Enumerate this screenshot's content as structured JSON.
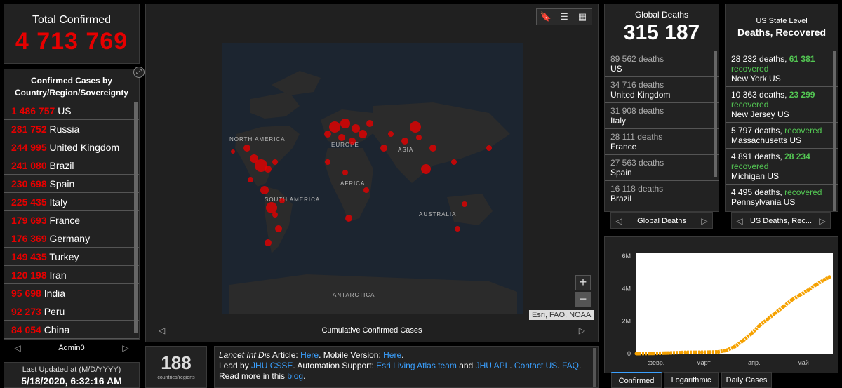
{
  "total": {
    "label": "Total Confirmed",
    "value": "4 713 769"
  },
  "countries": {
    "header": "Confirmed Cases by Country/Region/Sovereignty",
    "items": [
      {
        "value": "1 486 757",
        "name": "US"
      },
      {
        "value": "281 752",
        "name": "Russia"
      },
      {
        "value": "244 995",
        "name": "United Kingdom"
      },
      {
        "value": "241 080",
        "name": "Brazil"
      },
      {
        "value": "230 698",
        "name": "Spain"
      },
      {
        "value": "225 435",
        "name": "Italy"
      },
      {
        "value": "179 693",
        "name": "France"
      },
      {
        "value": "176 369",
        "name": "Germany"
      },
      {
        "value": "149 435",
        "name": "Turkey"
      },
      {
        "value": "120 198",
        "name": "Iran"
      },
      {
        "value": "95 698",
        "name": "India"
      },
      {
        "value": "92 273",
        "name": "Peru"
      },
      {
        "value": "84 054",
        "name": "China"
      }
    ],
    "pager_label": "Admin0"
  },
  "updated": {
    "label": "Last Updated at (M/D/YYYY)",
    "value": "5/18/2020, 6:32:16 AM"
  },
  "map": {
    "caption": "Cumulative Confirmed Cases",
    "attribution": "Esri, FAO, NOAA",
    "labels": [
      "NORTH AMERICA",
      "EUROPE",
      "ASIA",
      "AFRICA",
      "SOUTH AMERICA",
      "AUSTRALIA",
      "ANTARCTICA"
    ],
    "marker_color": "#e60000"
  },
  "count": {
    "value": "188",
    "label": "countries/regions"
  },
  "info": {
    "lancet": "Lancet Inf Dis",
    "t1": " Article: ",
    "l1": "Here",
    "t2": ". Mobile Version: ",
    "l2": "Here",
    "t3": ".",
    "t4": "Lead by ",
    "l3": "JHU CSSE",
    "t5": ". Automation Support: ",
    "l4": "Esri Living Atlas team",
    "t6": " and ",
    "l5": "JHU APL",
    "t7": ". ",
    "l6": "Contact US",
    "t8": ". ",
    "l7": "FAQ",
    "t9": ". Read more in this ",
    "l8": "blog",
    "t10": "."
  },
  "global_deaths": {
    "label": "Global Deaths",
    "value": "315 187",
    "items": [
      {
        "value": "89 562 deaths",
        "name": "US"
      },
      {
        "value": "34 716 deaths",
        "name": "United Kingdom"
      },
      {
        "value": "31 908 deaths",
        "name": "Italy"
      },
      {
        "value": "28 111 deaths",
        "name": "France"
      },
      {
        "value": "27 563 deaths",
        "name": "Spain"
      },
      {
        "value": "16 118 deaths",
        "name": "Brazil"
      }
    ],
    "pager_label": "Global Deaths"
  },
  "us": {
    "label": "US State Level",
    "label2": "Deaths, Recovered",
    "items": [
      {
        "deaths": "28 232 deaths,",
        "recovered": "61 381",
        "rec_word": "recovered",
        "name": "New York US"
      },
      {
        "deaths": "10 363 deaths,",
        "recovered": "23 299",
        "rec_word": "recovered",
        "name": "New Jersey US"
      },
      {
        "deaths": "5 797 deaths,",
        "recovered": "",
        "rec_word": "recovered",
        "name": "Massachusetts US"
      },
      {
        "deaths": "4 891 deaths,",
        "recovered": "28 234",
        "rec_word": "recovered",
        "name": "Michigan US"
      },
      {
        "deaths": "4 495 deaths,",
        "recovered": "",
        "rec_word": "recovered",
        "name": "Pennsylvania US"
      }
    ],
    "pager_label": "US Deaths, Rec..."
  },
  "chart_tabs": [
    "Confirmed",
    "Logarithmic",
    "Daily Cases"
  ],
  "chart_data": {
    "type": "line",
    "x_ticks": [
      "февр.",
      "март",
      "апр.",
      "май"
    ],
    "y_ticks": [
      "0",
      "2M",
      "4M",
      "6M"
    ],
    "ylim": [
      0,
      6000000
    ],
    "color": "#f5a100",
    "x": [
      0,
      10,
      20,
      30,
      40,
      45,
      50,
      55,
      60,
      65,
      70,
      75,
      80,
      85,
      90,
      95,
      100,
      105,
      110,
      115,
      118
    ],
    "values": [
      555,
      10000,
      40000,
      78000,
      85000,
      90000,
      110000,
      200000,
      420000,
      780000,
      1200000,
      1700000,
      2100000,
      2500000,
      2900000,
      3300000,
      3600000,
      3900000,
      4250000,
      4550000,
      4713769
    ],
    "x_tick_positions": [
      12,
      41,
      72,
      102
    ]
  }
}
